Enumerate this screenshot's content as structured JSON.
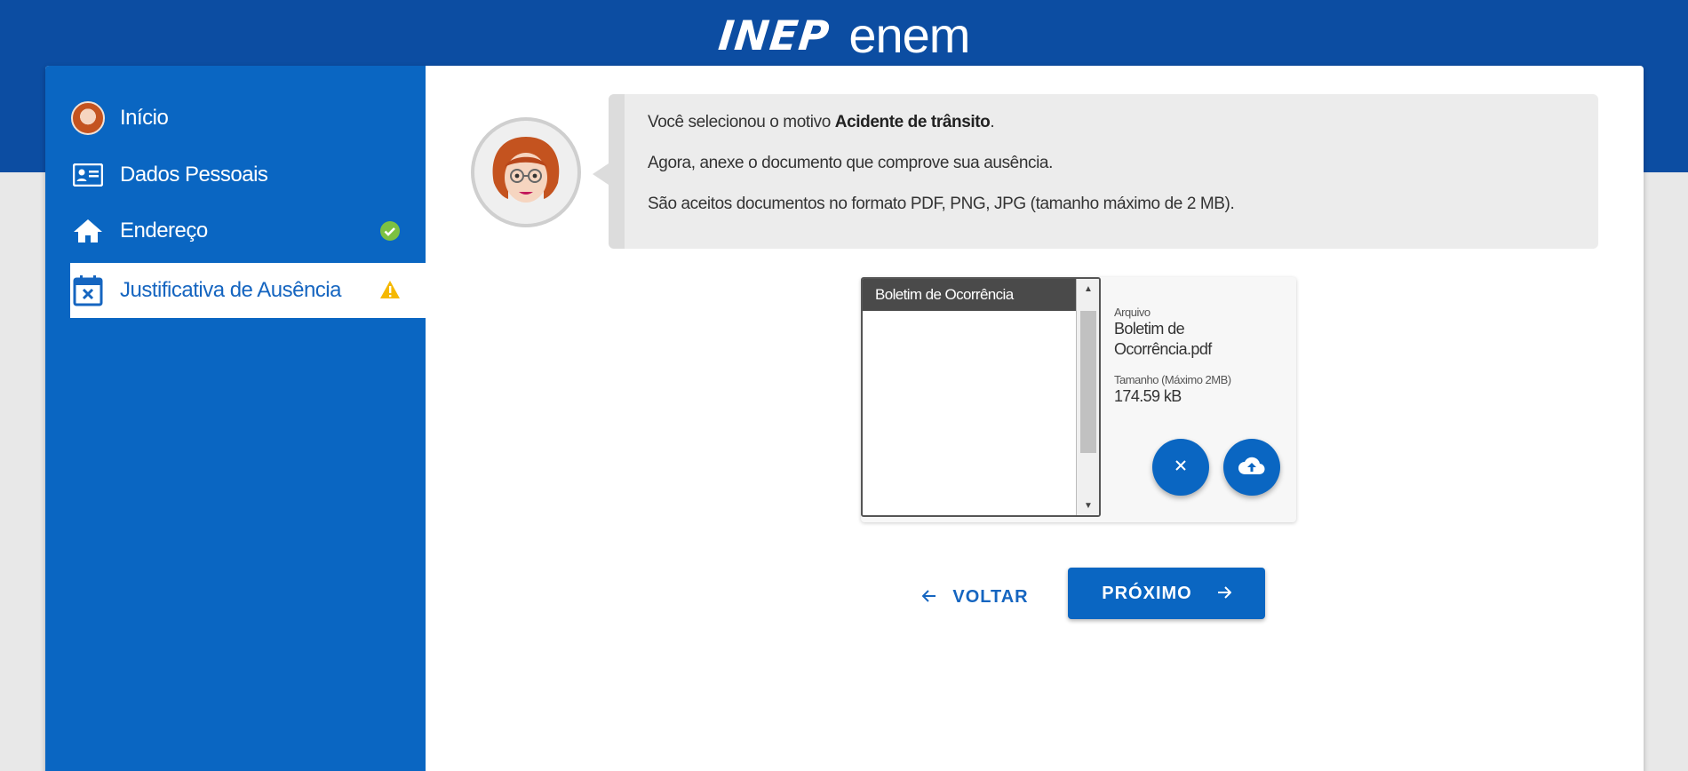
{
  "header": {
    "logo_inep": "INEP",
    "logo_enem": "enem"
  },
  "sidebar": {
    "items": [
      {
        "label": "Início",
        "icon": "avatar-icon",
        "status": null,
        "active": false
      },
      {
        "label": "Dados Pessoais",
        "icon": "id-card-icon",
        "status": null,
        "active": false
      },
      {
        "label": "Endereço",
        "icon": "home-icon",
        "status": "check-circle-icon",
        "active": false
      },
      {
        "label": "Justificativa de Ausência",
        "icon": "calendar-x-icon",
        "status": "warning-icon",
        "active": true
      }
    ]
  },
  "message": {
    "line1_prefix": "Você selecionou o motivo ",
    "line1_bold": "Acidente de trânsito",
    "line1_suffix": ".",
    "line2": "Agora, anexe o documento que comprove sua ausência.",
    "line3": "São aceitos documentos no formato PDF, PNG, JPG (tamanho máximo de 2 MB)."
  },
  "upload": {
    "selected_option": "Boletim de Ocorrência",
    "file_label": "Arquivo",
    "file_name": "Boletim de Ocorrência.pdf",
    "size_label": "Tamanho (Máximo 2MB)",
    "size_value": "174.59 kB",
    "remove_icon": "close-icon",
    "upload_icon": "cloud-upload-icon"
  },
  "actions": {
    "back_label": "VOLTAR",
    "next_label": "PRÓXIMO"
  },
  "colors": {
    "brand_blue": "#0c4da2",
    "sidebar_blue": "#0a66c2",
    "success": "#7cc142",
    "warning": "#f5b800"
  }
}
